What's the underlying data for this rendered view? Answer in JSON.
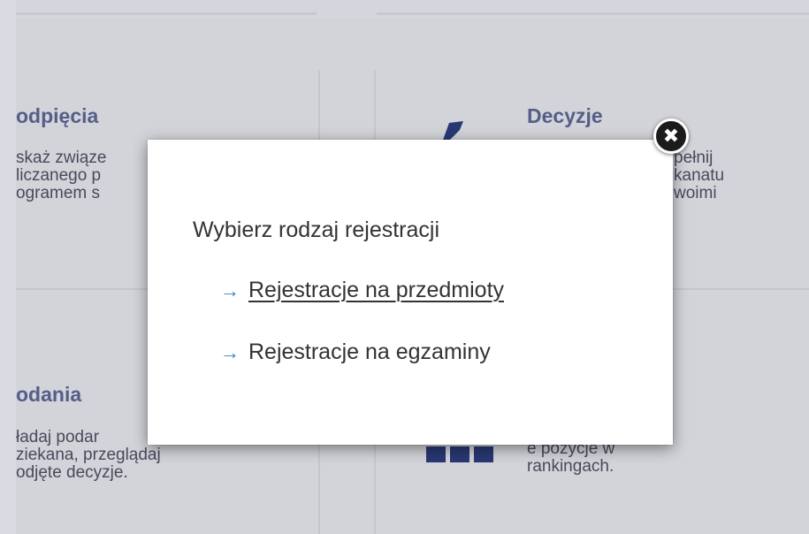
{
  "tiles": {
    "podpiecia": {
      "title": "odpięcia",
      "text": "skaż związe\nliczanego p\nogramem s"
    },
    "decyzje": {
      "title": "Decyzje",
      "text": "pełnij\nkanatu\nwoimi"
    },
    "podania": {
      "title": "odania",
      "text": "ładaj podar\nziekana, przeglądaj\nodjęte decyzje."
    },
    "rankingi": {
      "text": "e pozycje w\nrankingach."
    }
  },
  "modal": {
    "title": "Wybierz rodzaj rejestracji",
    "options": [
      {
        "arrow": "→",
        "label": "Rejestracje na przedmioty"
      },
      {
        "arrow": "→",
        "label": "Rejestracje na egzaminy"
      }
    ],
    "close_symbol": "✖"
  },
  "icons": {
    "decyzje": "pin-icon",
    "rankingi": "ranking-icon",
    "close": "close-icon"
  },
  "colors": {
    "accent": "#2f7fc4",
    "tile_title": "#5a6390",
    "icon_dark": "#2a3a7a"
  }
}
